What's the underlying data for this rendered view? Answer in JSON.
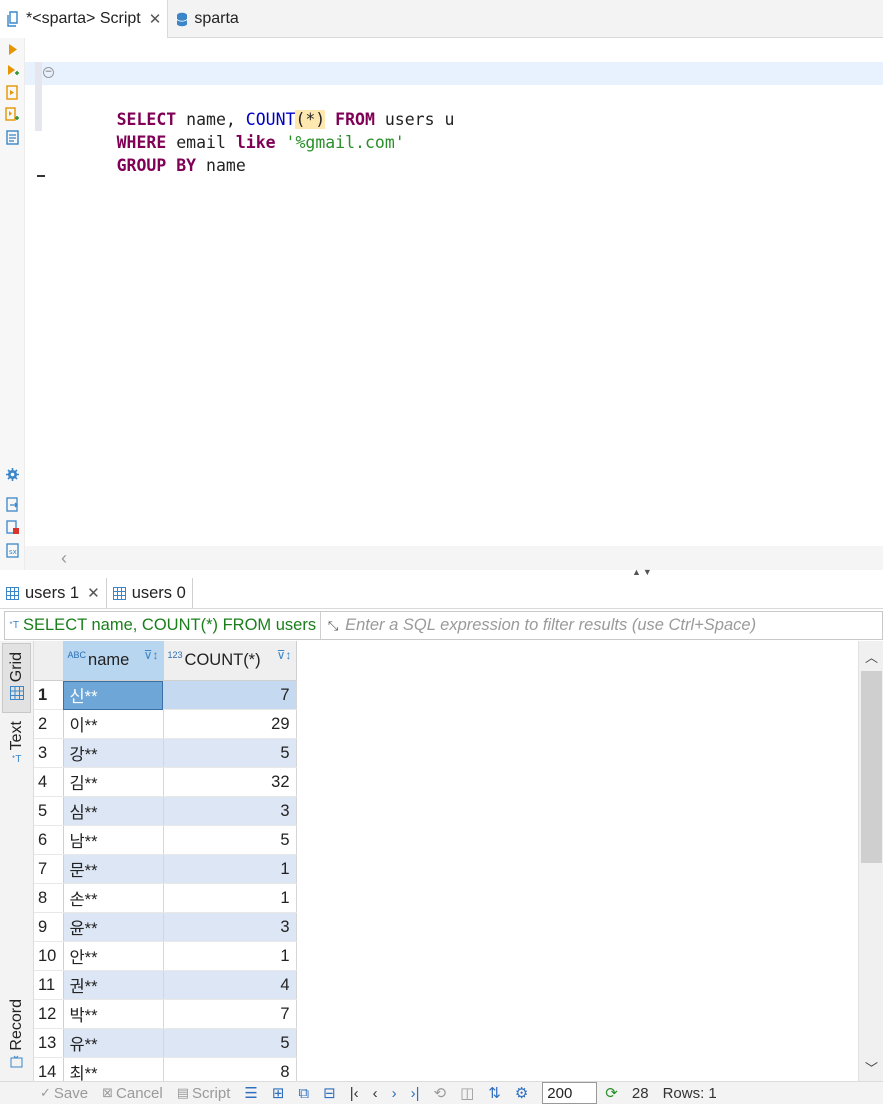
{
  "editor_tabs": [
    {
      "label": "*<sparta> Script",
      "icon": "sql-script-icon",
      "active": true,
      "closable": true
    },
    {
      "label": "sparta",
      "icon": "database-icon",
      "active": false,
      "closable": false
    }
  ],
  "sql": {
    "line1": {
      "kw1": "SELECT",
      "t1": " name, ",
      "fn": "COUNT",
      "p": "(*)",
      "kw2": " FROM",
      "t2": " users u"
    },
    "line2": {
      "kw1": "WHERE",
      "t1": " email ",
      "kw2": "like",
      "str": " '%gmail.com'"
    },
    "line3": {
      "kw1": "GROUP BY",
      "t1": " name"
    }
  },
  "result_tabs": [
    {
      "label": "users 1",
      "active": true,
      "closable": true
    },
    {
      "label": "users 0",
      "active": false,
      "closable": false
    }
  ],
  "filter": {
    "query_text": "SELECT name, COUNT(*) FROM users",
    "placeholder": "Enter a SQL expression to filter results (use Ctrl+Space)"
  },
  "view_tabs": {
    "grid": "Grid",
    "text": "Text",
    "record": "Record"
  },
  "grid": {
    "columns": [
      {
        "label": "name",
        "type_badge": "ABC"
      },
      {
        "label": "COUNT(*)",
        "type_badge": "123"
      }
    ],
    "rows": [
      {
        "n": "1",
        "name": "신**",
        "count": "7"
      },
      {
        "n": "2",
        "name": "이**",
        "count": "29"
      },
      {
        "n": "3",
        "name": "강**",
        "count": "5"
      },
      {
        "n": "4",
        "name": "김**",
        "count": "32"
      },
      {
        "n": "5",
        "name": "심**",
        "count": "3"
      },
      {
        "n": "6",
        "name": "남**",
        "count": "5"
      },
      {
        "n": "7",
        "name": "문**",
        "count": "1"
      },
      {
        "n": "8",
        "name": "손**",
        "count": "1"
      },
      {
        "n": "9",
        "name": "윤**",
        "count": "3"
      },
      {
        "n": "10",
        "name": "안**",
        "count": "1"
      },
      {
        "n": "11",
        "name": "권**",
        "count": "4"
      },
      {
        "n": "12",
        "name": "박**",
        "count": "7"
      },
      {
        "n": "13",
        "name": "유**",
        "count": "5"
      },
      {
        "n": "14",
        "name": "최**",
        "count": "8"
      }
    ],
    "selected_row": 1
  },
  "toolbar": {
    "save": "Save",
    "cancel": "Cancel",
    "script": "Script",
    "fetch_size": "200",
    "fetched": "28",
    "rows_status": "Rows: 1"
  },
  "colors": {
    "keyword": "#7f0055",
    "function": "#0000c0",
    "string": "#2a8f2a",
    "selection": "#6ea6d8",
    "alt_row": "#dde6f4"
  }
}
